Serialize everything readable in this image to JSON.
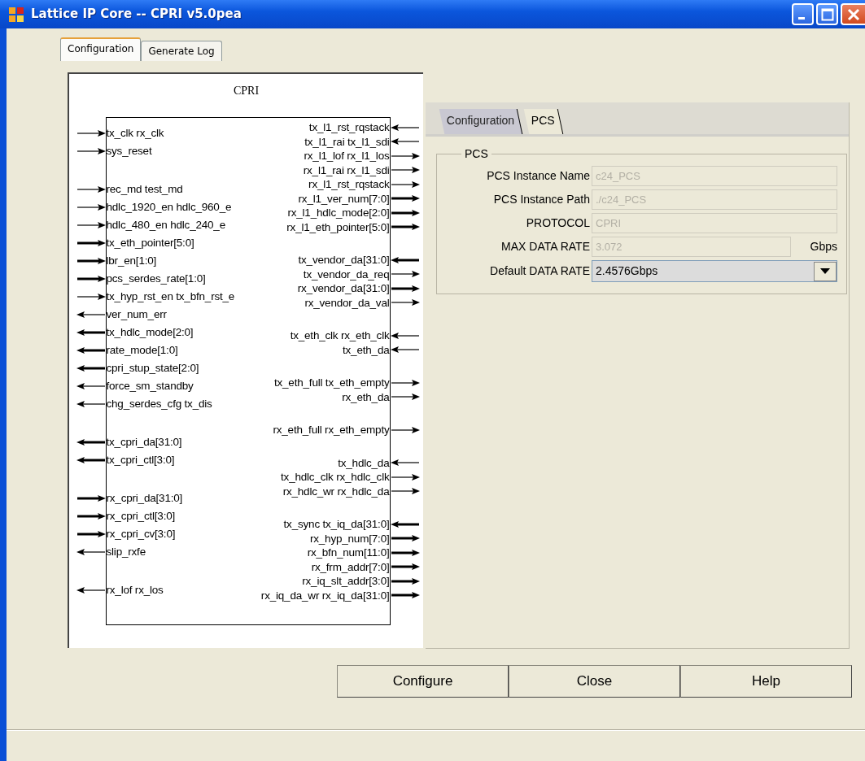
{
  "window": {
    "title": "Lattice IP Core -- CPRI v5.0pea"
  },
  "tabs": [
    {
      "label": "Configuration",
      "selected": true
    },
    {
      "label": "Generate Log",
      "selected": false
    }
  ],
  "diagram": {
    "title": "CPRI",
    "left_ports": [
      [
        {
          "label": "tx_clk rx_clk",
          "kind": "input",
          "bus": false
        },
        {
          "label": "sys_reset",
          "kind": "input",
          "bus": false
        }
      ],
      [
        {
          "label": "rec_md test_md",
          "kind": "input",
          "bus": false
        },
        {
          "label": "hdlc_1920_en hdlc_960_e",
          "kind": "input",
          "bus": false
        },
        {
          "label": "hdlc_480_en hdlc_240_e",
          "kind": "input",
          "bus": false
        },
        {
          "label": "tx_eth_pointer[5:0]",
          "kind": "input",
          "bus": true
        },
        {
          "label": "lbr_en[1:0]",
          "kind": "input",
          "bus": true
        },
        {
          "label": "pcs_serdes_rate[1:0]",
          "kind": "input",
          "bus": true
        },
        {
          "label": "tx_hyp_rst_en tx_bfn_rst_e",
          "kind": "input",
          "bus": false
        },
        {
          "label": "ver_num_err",
          "kind": "output",
          "bus": false
        },
        {
          "label": "tx_hdlc_mode[2:0]",
          "kind": "output",
          "bus": true
        },
        {
          "label": "rate_mode[1:0]",
          "kind": "output",
          "bus": true
        },
        {
          "label": "cpri_stup_state[2:0]",
          "kind": "output",
          "bus": true
        },
        {
          "label": "force_sm_standby",
          "kind": "output",
          "bus": false
        },
        {
          "label": "chg_serdes_cfg tx_dis",
          "kind": "output",
          "bus": false
        }
      ],
      [
        {
          "label": "tx_cpri_da[31:0]",
          "kind": "output",
          "bus": true
        },
        {
          "label": "tx_cpri_ctl[3:0]",
          "kind": "output",
          "bus": true
        }
      ],
      [
        {
          "label": "rx_cpri_da[31:0]",
          "kind": "input",
          "bus": true
        },
        {
          "label": "rx_cpri_ctl[3:0]",
          "kind": "input",
          "bus": true
        },
        {
          "label": "rx_cpri_cv[3:0]",
          "kind": "input",
          "bus": true
        },
        {
          "label": "slip_rxfe",
          "kind": "output",
          "bus": false
        }
      ],
      [
        {
          "label": "rx_lof rx_los",
          "kind": "output",
          "bus": false
        }
      ]
    ],
    "right_ports": [
      [
        {
          "label": "tx_l1_rst_rqstack",
          "kind": "input",
          "bus": false
        },
        {
          "label": "tx_l1_rai tx_l1_sdi",
          "kind": "input",
          "bus": false
        },
        {
          "label": "rx_l1_lof rx_l1_los",
          "kind": "output",
          "bus": false
        },
        {
          "label": "rx_l1_rai rx_l1_sdi",
          "kind": "output",
          "bus": false
        },
        {
          "label": "rx_l1_rst_rqstack",
          "kind": "output",
          "bus": false
        },
        {
          "label": "rx_l1_ver_num[7:0]",
          "kind": "output",
          "bus": true
        },
        {
          "label": "rx_l1_hdlc_mode[2:0]",
          "kind": "output",
          "bus": true
        },
        {
          "label": "rx_l1_eth_pointer[5:0]",
          "kind": "output",
          "bus": true
        }
      ],
      [
        {
          "label": "tx_vendor_da[31:0]",
          "kind": "input",
          "bus": true
        },
        {
          "label": "tx_vendor_da_req",
          "kind": "output",
          "bus": false
        },
        {
          "label": "rx_vendor_da[31:0]",
          "kind": "output",
          "bus": true
        },
        {
          "label": "rx_vendor_da_val",
          "kind": "output",
          "bus": false
        }
      ],
      [
        {
          "label": "tx_eth_clk rx_eth_clk",
          "kind": "input",
          "bus": false
        },
        {
          "label": "tx_eth_da",
          "kind": "input",
          "bus": false
        }
      ],
      [
        {
          "label": "tx_eth_full tx_eth_empty",
          "kind": "output",
          "bus": false
        },
        {
          "label": "rx_eth_da",
          "kind": "output",
          "bus": false
        }
      ],
      [
        {
          "label": "rx_eth_full rx_eth_empty",
          "kind": "output",
          "bus": false
        }
      ],
      [
        {
          "label": "tx_hdlc_da",
          "kind": "input",
          "bus": false
        },
        {
          "label": "tx_hdlc_clk rx_hdlc_clk",
          "kind": "output",
          "bus": false
        },
        {
          "label": "rx_hdlc_wr rx_hdlc_da",
          "kind": "output",
          "bus": false
        }
      ],
      [
        {
          "label": "tx_sync tx_iq_da[31:0]",
          "kind": "input",
          "bus": true
        },
        {
          "label": "rx_hyp_num[7:0]",
          "kind": "output",
          "bus": true
        },
        {
          "label": "rx_bfn_num[11:0]",
          "kind": "output",
          "bus": true
        },
        {
          "label": "rx_frm_addr[7:0]",
          "kind": "output",
          "bus": true
        },
        {
          "label": "rx_iq_slt_addr[3:0]",
          "kind": "output",
          "bus": true
        },
        {
          "label": "rx_iq_da_wr rx_iq_da[31:0]",
          "kind": "output",
          "bus": true
        }
      ]
    ]
  },
  "panel": {
    "tabs": [
      {
        "label": "Configuration",
        "selected": false
      },
      {
        "label": "PCS",
        "selected": true
      }
    ],
    "group": {
      "title": "PCS",
      "fields": [
        {
          "label": "PCS Instance Name",
          "kind": "text",
          "value": "c24_PCS",
          "disabled": true
        },
        {
          "label": "PCS Instance Path",
          "kind": "text",
          "value": "./c24_PCS",
          "disabled": true
        },
        {
          "label": "PROTOCOL",
          "kind": "text",
          "value": "CPRI",
          "disabled": true
        },
        {
          "label": "MAX DATA RATE",
          "kind": "text",
          "value": "3.072",
          "disabled": true,
          "unit": "Gbps"
        },
        {
          "label": "Default DATA RATE",
          "kind": "select",
          "value": "2.4576Gbps",
          "disabled": false
        }
      ]
    }
  },
  "buttons": [
    "Configure",
    "Close",
    "Help"
  ]
}
